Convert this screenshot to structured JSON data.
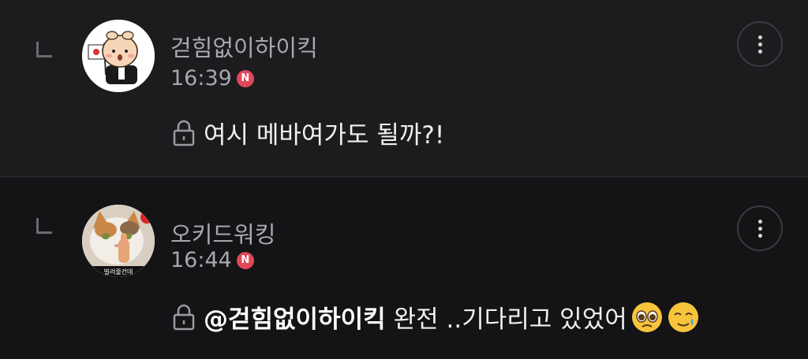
{
  "replies": [
    {
      "username": "걷힘없이하이킥",
      "time": "16:39",
      "badge": "N",
      "mention": "",
      "message": "여시 메바여가도 될까?!",
      "avatar": "character-with-flag-avatar"
    },
    {
      "username": "오키드워킹",
      "time": "16:44",
      "badge": "N",
      "mention": "@걷힘없이하이킥",
      "message": "완전 ..기다리고 있었어",
      "avatar": "cat-photo-avatar",
      "avatar_caption": "빌려줄건데",
      "emojis": [
        "pleading-face-emoji",
        "smiling-face-with-tear-emoji"
      ]
    }
  ],
  "colors": {
    "background": "#1c1c1f",
    "background_alt": "#141416",
    "badge": "#e0485a",
    "meta_text": "#a8a8ad"
  }
}
